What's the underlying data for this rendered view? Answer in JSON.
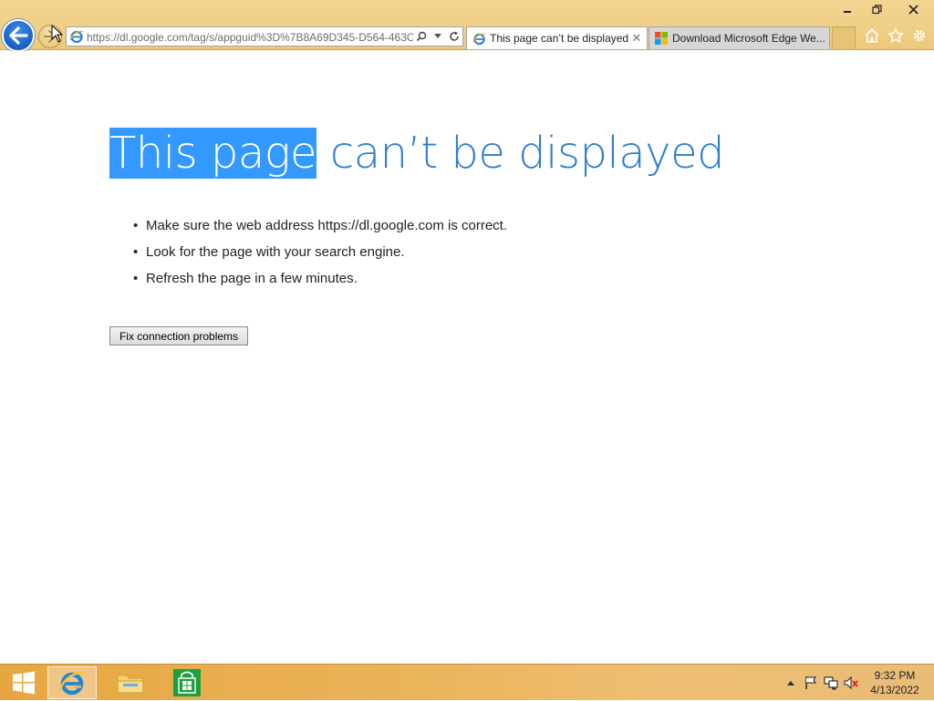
{
  "browser": {
    "address": "https://dl.google.com/tag/s/appguid%3D%7B8A69D345-D564-463C",
    "tabs": [
      {
        "label": "This page can’t be displayed",
        "active": true
      },
      {
        "label": "Download Microsoft Edge We...",
        "active": false
      }
    ]
  },
  "page": {
    "title_selected": "This page",
    "title_rest": " can’t be displayed",
    "suggestions": [
      "Make sure the web address https://dl.google.com is correct.",
      "Look for the page with your search engine.",
      "Refresh the page in a few minutes."
    ],
    "fix_button": "Fix connection problems"
  },
  "taskbar": {
    "time": "9:32 PM",
    "date": "4/13/2022"
  },
  "colors": {
    "title_blue": "#2f7fd1",
    "selection_blue": "#3399ff",
    "chrome_gold": "#f0cf88"
  }
}
